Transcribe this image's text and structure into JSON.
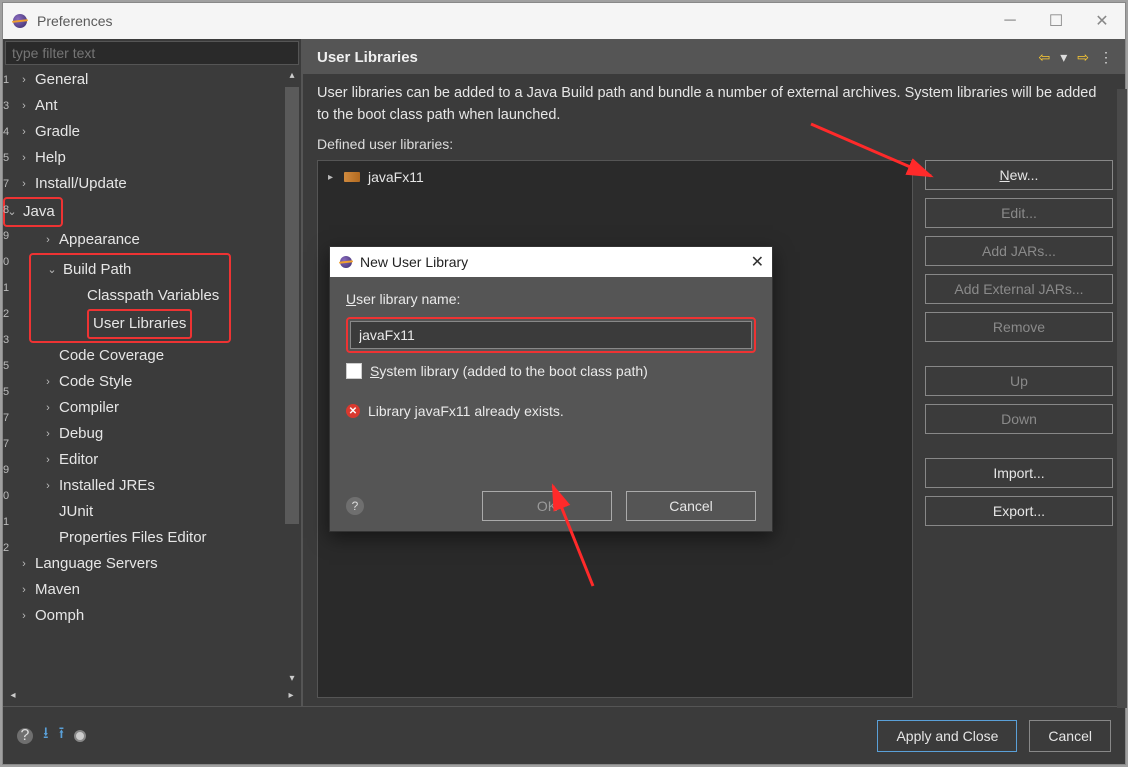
{
  "window": {
    "title": "Preferences"
  },
  "filter_placeholder": "type filter text",
  "tree": {
    "general": "General",
    "ant": "Ant",
    "gradle": "Gradle",
    "help": "Help",
    "install": "Install/Update",
    "java": "Java",
    "appearance": "Appearance",
    "buildpath": "Build Path",
    "classpath": "Classpath Variables",
    "userlibs": "User Libraries",
    "codecov": "Code Coverage",
    "codestyle": "Code Style",
    "compiler": "Compiler",
    "debug": "Debug",
    "editor": "Editor",
    "jres": "Installed JREs",
    "junit": "JUnit",
    "propfiles": "Properties Files Editor",
    "lang": "Language Servers",
    "maven": "Maven",
    "oomph": "Oomph"
  },
  "panel": {
    "title": "User Libraries",
    "desc": "User libraries can be added to a Java Build path and bundle a number of external archives. System libraries will be added to the boot class path when launched.",
    "sub": "Defined user libraries:",
    "entry": "javaFx11"
  },
  "buttons": {
    "new": "New...",
    "edit": "Edit...",
    "addjars": "Add JARs...",
    "addext": "Add External JARs...",
    "remove": "Remove",
    "up": "Up",
    "down": "Down",
    "import": "Import...",
    "export": "Export..."
  },
  "dialog": {
    "title": "New User Library",
    "label": "User library name:",
    "value": "javaFx11",
    "checkbox": "System library (added to the boot class path)",
    "error": "Library javaFx11 already exists.",
    "ok": "OK",
    "cancel": "Cancel"
  },
  "footer": {
    "apply": "Apply and Close",
    "cancel": "Cancel"
  }
}
